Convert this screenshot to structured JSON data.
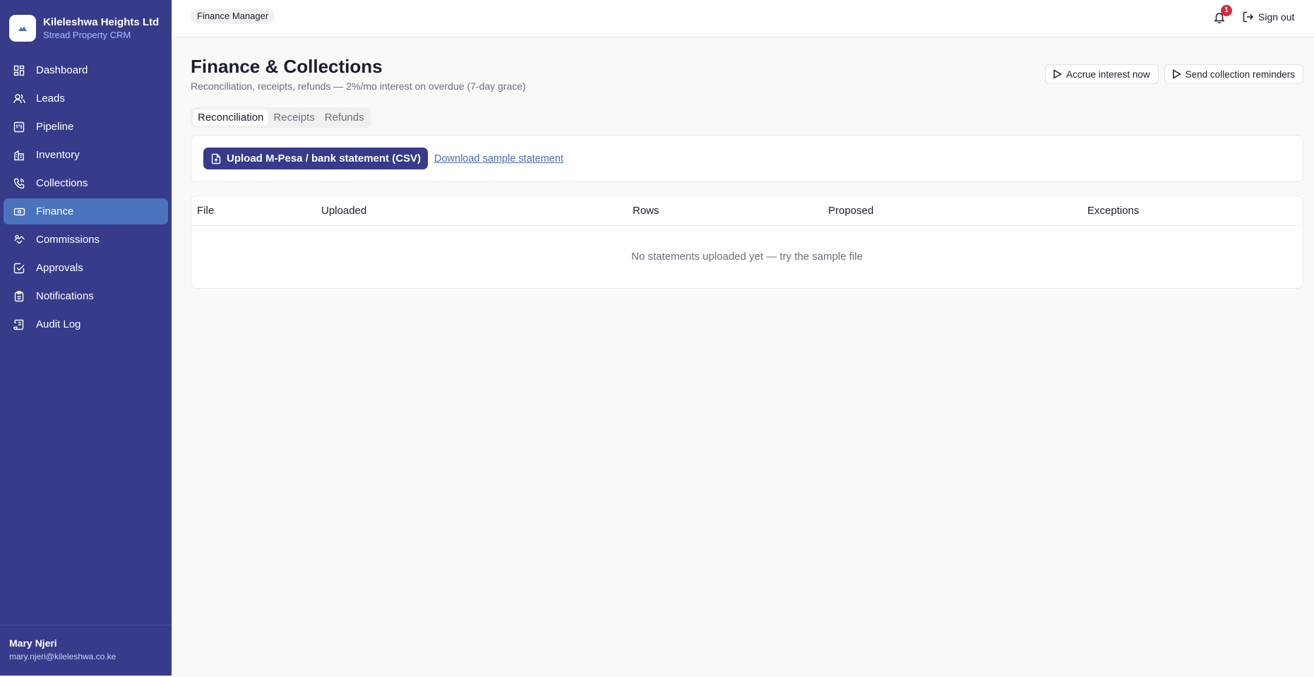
{
  "brand": {
    "name": "Kileleshwa Heights Ltd",
    "subtitle": "Stread Property CRM",
    "accent_color": "#383a8a",
    "subtitle_color": "#9fc3ff"
  },
  "sidebar": {
    "items": [
      {
        "label": "Dashboard",
        "icon": "dashboard-grid-icon"
      },
      {
        "label": "Leads",
        "icon": "users-icon"
      },
      {
        "label": "Pipeline",
        "icon": "kanban-icon"
      },
      {
        "label": "Inventory",
        "icon": "building-icon"
      },
      {
        "label": "Collections",
        "icon": "phone-icon"
      },
      {
        "label": "Finance",
        "icon": "banknote-icon",
        "active": true
      },
      {
        "label": "Commissions",
        "icon": "handshake-icon"
      },
      {
        "label": "Approvals",
        "icon": "check-square-icon"
      },
      {
        "label": "Notifications",
        "icon": "clipboard-icon"
      },
      {
        "label": "Audit Log",
        "icon": "scroll-icon"
      }
    ],
    "active_color": "#4a72bd"
  },
  "user": {
    "name": "Mary Njeri",
    "email": "mary.njeri@kileleshwa.co.ke"
  },
  "topbar": {
    "role": "Finance Manager",
    "notification_count": "1",
    "signout_label": "Sign out"
  },
  "page": {
    "title": "Finance & Collections",
    "subtitle": "Reconciliation, receipts, refunds — 2%/mo interest on overdue (7-day grace)",
    "actions": {
      "accrue_label": "Accrue interest now",
      "reminders_label": "Send collection reminders"
    }
  },
  "tabs": [
    {
      "label": "Reconciliation",
      "active": true
    },
    {
      "label": "Receipts",
      "active": false
    },
    {
      "label": "Refunds",
      "active": false
    }
  ],
  "upload": {
    "button_label": "Upload M-Pesa / bank statement (CSV)",
    "sample_link": "Download sample statement"
  },
  "table": {
    "columns": [
      "File",
      "Uploaded",
      "Rows",
      "Proposed",
      "Exceptions"
    ],
    "empty_message": "No statements uploaded yet — try the sample file"
  }
}
